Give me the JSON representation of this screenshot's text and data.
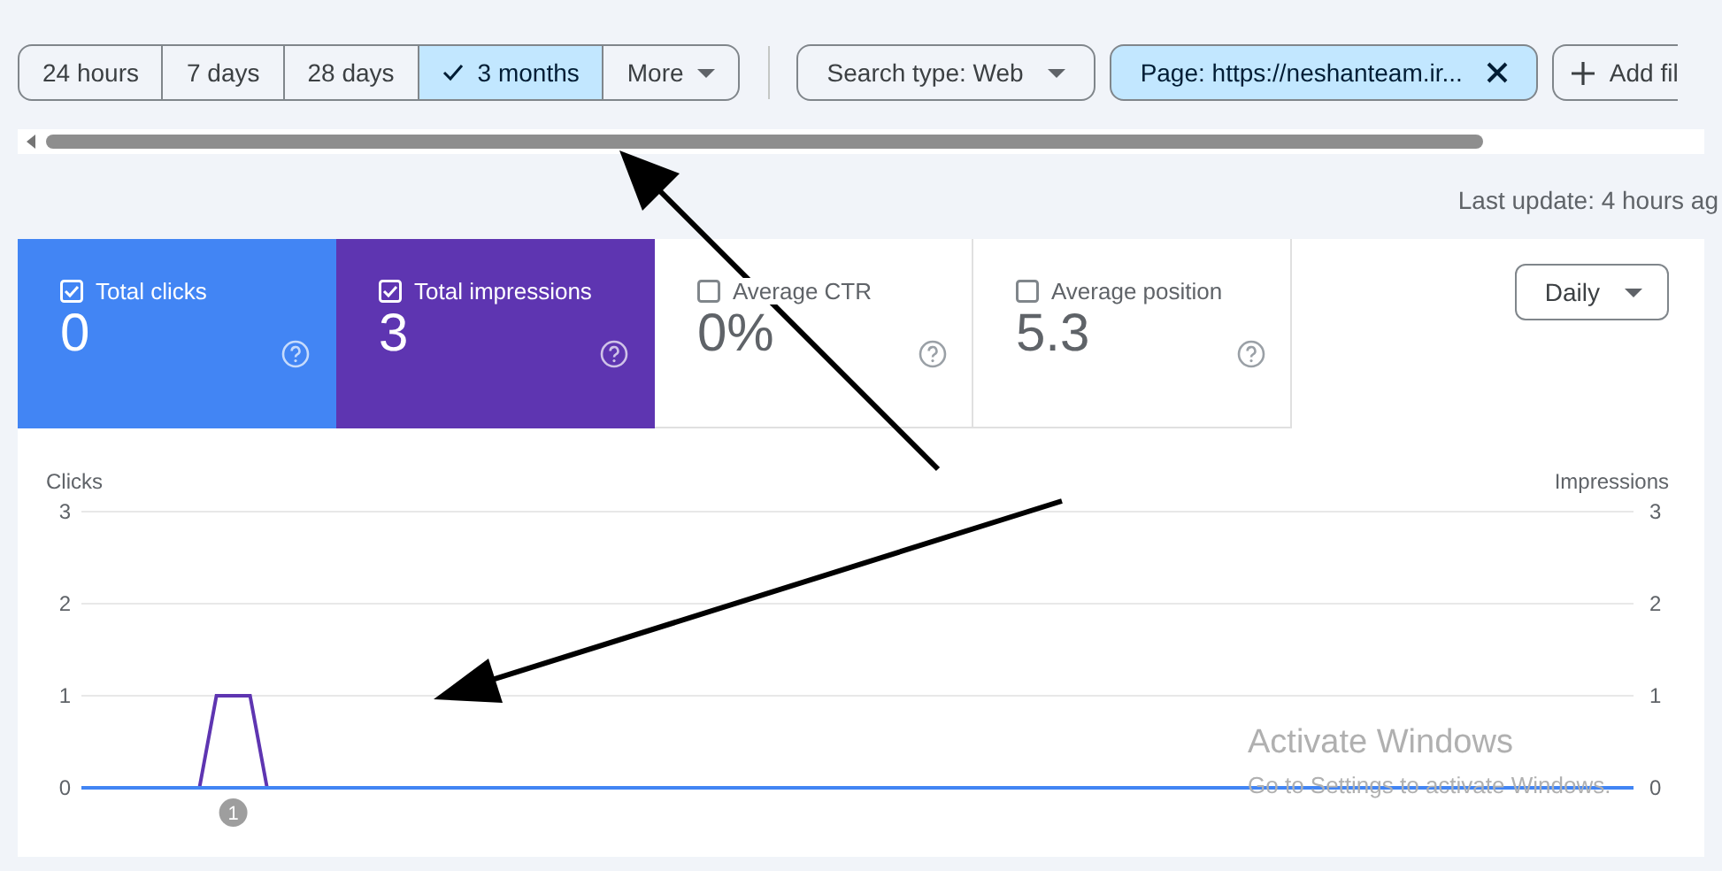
{
  "date_range": {
    "options": [
      {
        "label": "24 hours",
        "selected": false
      },
      {
        "label": "7 days",
        "selected": false
      },
      {
        "label": "28 days",
        "selected": false
      },
      {
        "label": "3 months",
        "selected": true
      }
    ],
    "more": {
      "label": "More"
    }
  },
  "filters": [
    {
      "kind": "dropdown",
      "label": "Search type: Web",
      "selected": false
    },
    {
      "kind": "removable",
      "label": "Page: https://neshanteam.ir...",
      "selected": true
    },
    {
      "kind": "add",
      "label": "Add fil",
      "selected": false
    }
  ],
  "last_update": "Last update: 4 hours ag",
  "metrics": [
    {
      "label": "Total clicks",
      "value": "0",
      "checked": true,
      "color": "#4285f4"
    },
    {
      "label": "Total impressions",
      "value": "3",
      "checked": true,
      "color": "#5e35b1"
    },
    {
      "label": "Average CTR",
      "value": "0%",
      "checked": false
    },
    {
      "label": "Average position",
      "value": "5.3",
      "checked": false
    }
  ],
  "granularity": {
    "label": "Daily"
  },
  "chart": {
    "right_axis": {
      "label": "Impressions",
      "ticks": [
        "3",
        "2",
        "1",
        "0"
      ]
    },
    "markers": [
      {
        "label": "1"
      }
    ],
    "chart_data": {
      "type": "line",
      "ylabel": "Clicks",
      "ylim": [
        0,
        3
      ],
      "yticks": [
        0,
        1,
        2,
        3
      ],
      "series": [
        {
          "color": "#5e35b1",
          "values": [
            null,
            null,
            null,
            null,
            null,
            null,
            null,
            0,
            1,
            1,
            1,
            0,
            null,
            null,
            null,
            null,
            null,
            null,
            null,
            null,
            null,
            null,
            null,
            null,
            null,
            null,
            null,
            null,
            null,
            null,
            null,
            null,
            null,
            null,
            null,
            null,
            null,
            null,
            null,
            null,
            null,
            null,
            null,
            null,
            null,
            null,
            null,
            null,
            null,
            null,
            null,
            null,
            null,
            null,
            null,
            null,
            null,
            null,
            null,
            null,
            null,
            null,
            null,
            null,
            null,
            null,
            null,
            null,
            null,
            null,
            null,
            null,
            null,
            null,
            null,
            null,
            null,
            null,
            null,
            null,
            null,
            null,
            null,
            null,
            null,
            null,
            null,
            null,
            null,
            null,
            null,
            null,
            null
          ]
        },
        {
          "color": "#4285f4",
          "values": [
            0,
            0,
            0,
            0,
            0,
            0,
            0,
            0,
            0,
            0,
            0,
            0,
            0,
            0,
            0,
            0,
            0,
            0,
            0,
            0,
            0,
            0,
            0,
            0,
            0,
            0,
            0,
            0,
            0,
            0,
            0,
            0,
            0,
            0,
            0,
            0,
            0,
            0,
            0,
            0,
            0,
            0,
            0,
            0,
            0,
            0,
            0,
            0,
            0,
            0,
            0,
            0,
            0,
            0,
            0,
            0,
            0,
            0,
            0,
            0,
            0,
            0,
            0,
            0,
            0,
            0,
            0,
            0,
            0,
            0,
            0,
            0,
            0,
            0,
            0,
            0,
            0,
            0,
            0,
            0,
            0,
            0,
            0,
            0,
            0,
            0,
            0,
            0,
            0,
            0,
            0,
            0,
            0
          ]
        }
      ]
    }
  },
  "os_notice": {
    "title": "Activate Windows",
    "text": "Go to Settings to activate Windows."
  }
}
